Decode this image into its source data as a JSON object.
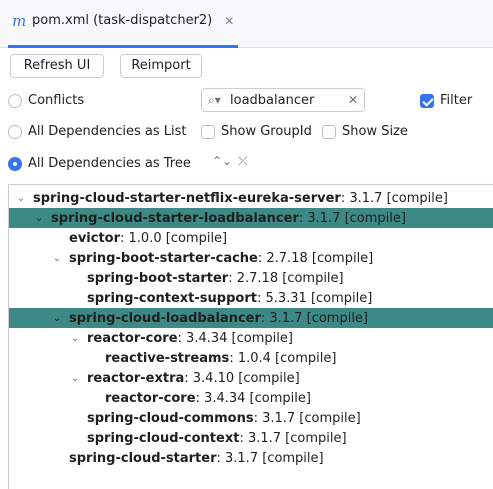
{
  "tab": {
    "icon": "m",
    "title": "pom.xml (task-dispatcher2)",
    "close": "✕"
  },
  "toolbar": {
    "refresh_label": "Refresh UI",
    "reimport_label": "Reimport"
  },
  "options": {
    "conflicts": "Conflicts",
    "list": "All Dependencies as List",
    "tree": "All Dependencies as Tree",
    "show_groupid": "Show GroupId",
    "show_size": "Show Size",
    "filter": "Filter"
  },
  "search": {
    "value": "loadbalancer",
    "icon": "⌕▾",
    "clear": "✕"
  },
  "tree_controls": {
    "expand": "⌃⌄",
    "collapse": "⤫"
  },
  "tree": [
    {
      "name": "spring-cloud-starter-netflix-eureka-server",
      "version": " : 3.1.7 [compile]",
      "level": 0,
      "expanded": true,
      "selected": false
    },
    {
      "name": "spring-cloud-starter-loadbalancer",
      "version": " : 3.1.7 [compile]",
      "level": 1,
      "expanded": true,
      "selected": true
    },
    {
      "name": "evictor",
      "version": " : 1.0.0 [compile]",
      "level": 2,
      "expanded": null,
      "selected": false
    },
    {
      "name": "spring-boot-starter-cache",
      "version": " : 2.7.18 [compile]",
      "level": 2,
      "expanded": true,
      "selected": false
    },
    {
      "name": "spring-boot-starter",
      "version": " : 2.7.18 [compile]",
      "level": 3,
      "expanded": null,
      "selected": false
    },
    {
      "name": "spring-context-support",
      "version": " : 5.3.31 [compile]",
      "level": 3,
      "expanded": null,
      "selected": false
    },
    {
      "name": "spring-cloud-loadbalancer",
      "version": " : 3.1.7 [compile]",
      "level": 2,
      "expanded": true,
      "selected": true
    },
    {
      "name": "reactor-core",
      "version": " : 3.4.34 [compile]",
      "level": 3,
      "expanded": true,
      "selected": false
    },
    {
      "name": "reactive-streams",
      "version": " : 1.0.4 [compile]",
      "level": 4,
      "expanded": null,
      "selected": false
    },
    {
      "name": "reactor-extra",
      "version": " : 3.4.10 [compile]",
      "level": 3,
      "expanded": true,
      "selected": false
    },
    {
      "name": "reactor-core",
      "version": " : 3.4.34 [compile]",
      "level": 4,
      "expanded": null,
      "selected": false
    },
    {
      "name": "spring-cloud-commons",
      "version": " : 3.1.7 [compile]",
      "level": 3,
      "expanded": null,
      "selected": false
    },
    {
      "name": "spring-cloud-context",
      "version": " : 3.1.7 [compile]",
      "level": 3,
      "expanded": null,
      "selected": false
    },
    {
      "name": "spring-cloud-starter",
      "version": " : 3.1.7 [compile]",
      "level": 2,
      "expanded": null,
      "selected": false
    }
  ],
  "colors": {
    "accent": "#3574f0",
    "selection": "#3d8986"
  }
}
